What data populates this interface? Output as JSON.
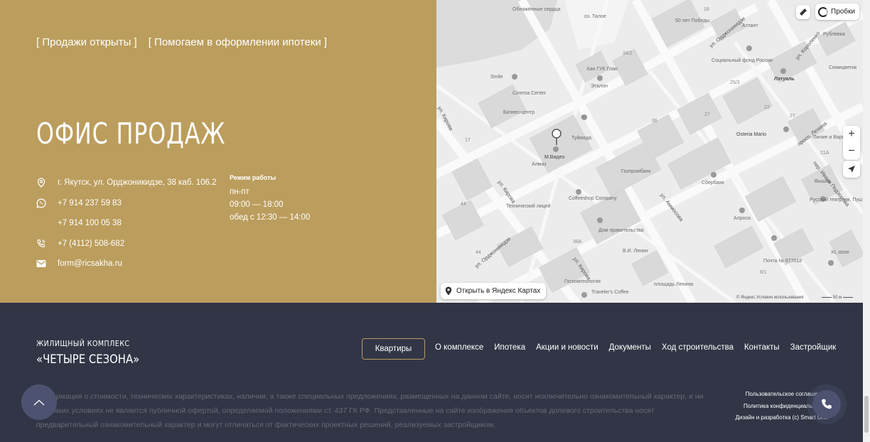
{
  "office": {
    "tags": [
      "[ Продажи открыты ]",
      "[ Помогаем в оформлении ипотеки ]"
    ],
    "title": "ОФИС ПРОДАЖ",
    "address": "г. Якутск, ул. Орджоникидзе, 38 каб. 106.2",
    "phone1": "+7 914 237 59 83",
    "phone2": "+7 914 100 05 38",
    "phone3": "+7 (4112) 508-682",
    "email": "form@ricsakha.ru",
    "hours_label": "Режим работы",
    "hours_days": "пн-пт",
    "hours_time": "09:00 — 18:00",
    "hours_lunch": "обед с 12:30 — 14:00",
    "colors": {
      "panel": "#bb9d5d"
    }
  },
  "map": {
    "traffic_label": "Пробки",
    "zoom_in": "+",
    "zoom_out": "−",
    "open_label": "Открыть в Яндекс Картах",
    "copyright": "© Яндекс   Условия использования",
    "scale": "50 м",
    "labels": {
      "obelisk": "Обнажённые сердца",
      "lake": "оз. Талое",
      "pobedy": "50 лет Победы",
      "atlant": "Атлант",
      "rublevka": "Рублевка",
      "semicvet": "Семицветик",
      "sociafond": "Социальный фонд России",
      "lyatual": "Лэтуаль",
      "khanguk": "Хан ГУК Глан",
      "etalon": "Эталон",
      "cinema": "Cinema Center",
      "biz": "Бизнес-центр",
      "smile": "Smile",
      "tuymaada": "Туймада",
      "mvideo": "М.Видео",
      "almaz": "Алмаз",
      "gazprom": "Газпромбанк",
      "sber": "Сбербанк",
      "osteria": "Osteria Mario",
      "lilie": "Лилие и Варим",
      "coffeeshop": "Coffeeshop Company",
      "tehlic": "Технический лицей",
      "dom": "Дом правительства",
      "lenin": "В.И. Ленин",
      "alrosa": "Алроса",
      "rusteatr": "Русский театр им. Пушкина",
      "vyshka": "Вышка",
      "pochta": "Почта № 677018",
      "xlstore": "XL store",
      "goskom": "Госкомгеология",
      "travelers": "Traveler's Coffee",
      "plosh": "площадь Ленина"
    },
    "streets": {
      "kirova1": "ул. Кирова",
      "kirova2": "ул. Кирова",
      "kirova3": "ул. Кирова",
      "ordzh1": "ул. Орджоникидзе",
      "ordzh2": "ул. Орджоникидзе",
      "ammosova": "ул. Аммосова",
      "korolenko": "ул. Короленко",
      "lenina": "просп. Ленина",
      "podzorova": "пер. Ивана Подзорова"
    }
  },
  "footer": {
    "logo_small": "ЖИЛИЩНЫЙ КОМПЛЕКС",
    "logo_big": "«ЧЕТЫРЕ СЕЗОНА»",
    "nav_button": "Квартиры",
    "nav": [
      "О комплексе",
      "Ипотека",
      "Акции и новости",
      "Документы",
      "Ход строительства",
      "Контакты",
      "Застройщик"
    ],
    "disclaimer": "Информация о стоимости, технических характеристиках, наличии, а также специальных предложениях, размещенных на данном сайте, носит исключительно ознакомительный характер, и ни при каких условиях не является публичной офертой, определяемой положениями ст. 437 ГК РФ. Представленные на сайте изображения объектов долевого строительства носят предварительный ознакомительный характер и могут отличаться от фактических проектных решений, реализуемых застройщиком.",
    "links": [
      "Пользовательское соглашение",
      "Политика конфиденциальности",
      "Дизайн и разработка (c) Smart Unit"
    ],
    "colors": {
      "bg": "#323546",
      "accent": "#b89a62"
    }
  }
}
